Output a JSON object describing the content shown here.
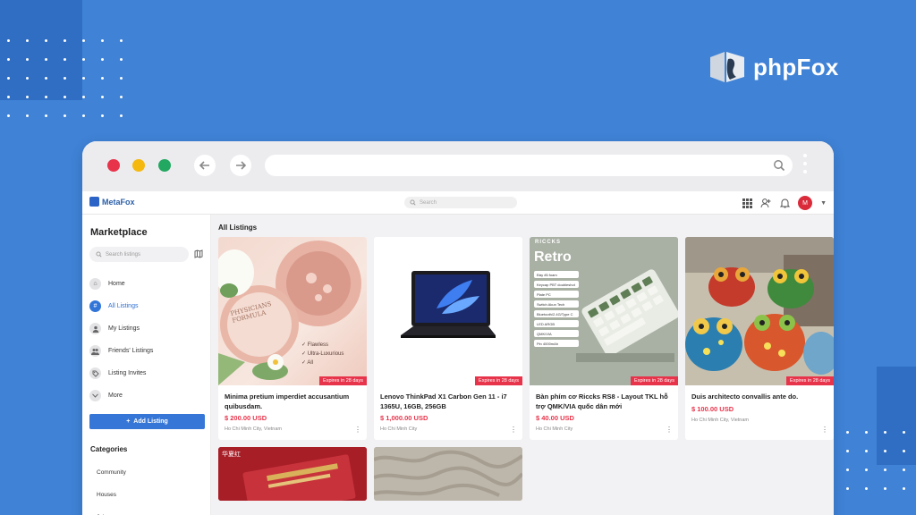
{
  "brand": {
    "name": "phpFox"
  },
  "app": {
    "logo_text": "MetaFox",
    "search_placeholder": "Search",
    "avatar_initial": "M"
  },
  "sidebar": {
    "title": "Marketplace",
    "search_placeholder": "Search listings",
    "items": [
      {
        "label": "Home",
        "icon": "home-icon"
      },
      {
        "label": "All Listings",
        "icon": "hash-icon",
        "active": true
      },
      {
        "label": "My Listings",
        "icon": "user-icon"
      },
      {
        "label": "Friends' Listings",
        "icon": "friends-icon"
      },
      {
        "label": "Listing Invites",
        "icon": "tag-icon"
      },
      {
        "label": "More",
        "icon": "chevron-down-icon"
      }
    ],
    "add_button": "Add Listing",
    "categories_title": "Categories",
    "categories": [
      "Community",
      "Houses",
      "Jobs"
    ]
  },
  "main": {
    "title": "All Listings",
    "listings": [
      {
        "title": "Minima pretium imperdiet accusantium quibusdam.",
        "price": "$ 200.00 USD",
        "location": "Ho Chi Minh City, Vietnam",
        "badge": "Expires in 28 days",
        "image_text": {
          "brand": "PHYSICIANS FORMULA",
          "bullets": [
            "Flawless",
            "Ultra-Luxurious",
            "All"
          ]
        }
      },
      {
        "title": "Lenovo ThinkPad X1 Carbon Gen 11 - i7 1365U, 16GB, 256GB",
        "price": "$ 1,000.00 USD",
        "location": "Ho Chi Minh City",
        "badge": "Expires in 28 days"
      },
      {
        "title": "Bàn phím cơ Riccks RS8 - Layout TKL hỗ trợ QMK/VIA quốc dân mới",
        "price": "$ 40.00 USD",
        "location": "Ho Chi Minh City",
        "badge": "Expires in 28 days",
        "image_text": {
          "brand": "RICCKS",
          "headline": "Retro",
          "specs": [
            "Đầy đủ foam",
            "Keycap PBT doubleshot",
            "Plate PC",
            "Switch Akun Tech",
            "Bluetooth/2.4G/Type C",
            "LED ARGB",
            "QMK/VIA",
            "Pin 4000mAh"
          ]
        }
      },
      {
        "title": "Duis architecto convallis ante do.",
        "price": "$ 100.00 USD",
        "location": "Ho Chi Minh City, Vietnam",
        "badge": "Expires in 28 days"
      },
      {
        "title": "",
        "price": "",
        "location": "",
        "badge": "",
        "image_text": {
          "brand": "华夏红"
        }
      },
      {
        "title": "",
        "price": "",
        "location": "",
        "badge": ""
      }
    ]
  },
  "colors": {
    "background": "#3f82d6",
    "accent": "#3676d6",
    "price": "#e8344b"
  }
}
